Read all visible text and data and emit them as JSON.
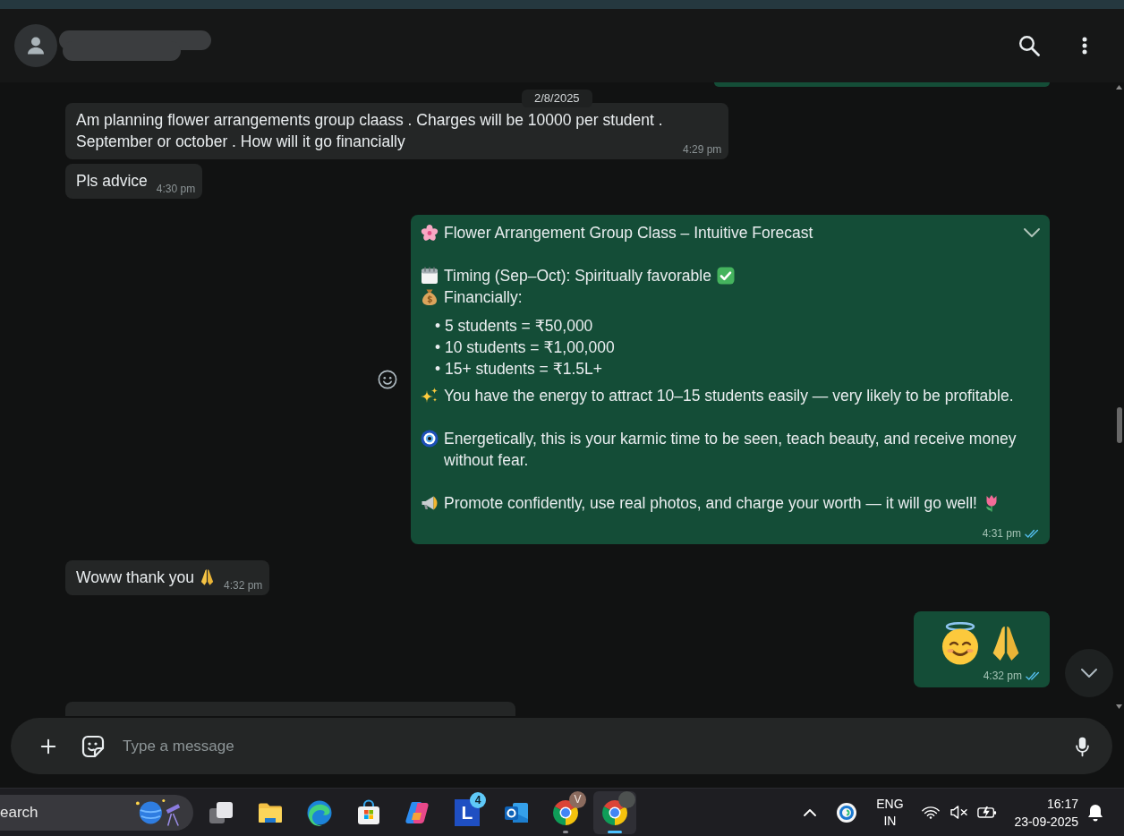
{
  "date_divider": "2/8/2025",
  "messages": [
    {
      "kind": "clipped",
      "outgoing": true
    },
    {
      "kind": "text",
      "outgoing": false,
      "hovered": false,
      "text": "Am planning flower arrangements group claass . Charges will be 10000 per student . September or october . How will it go financially",
      "time": "4:29 pm"
    },
    {
      "kind": "text",
      "outgoing": false,
      "hovered": false,
      "text": "Pls advice",
      "time": "4:30 pm"
    },
    {
      "kind": "forecast",
      "outgoing": true,
      "hovered": true,
      "paragraphs": [
        {
          "lines": [
            {
              "kind": "title",
              "text": "Flower Arrangement Group Class – Intuitive Forecast"
            }
          ]
        },
        {
          "lines": [
            {
              "kind": "timing",
              "text": "Timing (Sep–Oct): Spiritually favorable"
            },
            {
              "kind": "money",
              "text": "Financially:"
            },
            {
              "kind": "bullet",
              "text": "• 5 students = ₹50,000"
            },
            {
              "kind": "bullet",
              "text": "• 10 students = ₹1,00,000"
            },
            {
              "kind": "bullet",
              "text": "• 15+ students = ₹1.5L+"
            },
            {
              "kind": "sparkle",
              "text": "You have the energy to attract 10–15 students easily — very likely to be profitable."
            }
          ]
        },
        {
          "lines": [
            {
              "kind": "eye",
              "text": "Energetically, this is your karmic time to be seen, teach beauty, and receive money without fear."
            }
          ]
        },
        {
          "lines": [
            {
              "kind": "megaphone",
              "text": "Promote confidently, use real photos, and charge your worth — it will go well!"
            }
          ]
        }
      ],
      "time": "4:31 pm",
      "read": true
    },
    {
      "kind": "thanks",
      "outgoing": false,
      "hovered": false,
      "text": "Woww thank you",
      "time": "4:32 pm"
    },
    {
      "kind": "reaction",
      "outgoing": true,
      "hovered": false,
      "time": "4:32 pm",
      "read": true
    },
    {
      "kind": "clipped",
      "outgoing": false
    }
  ],
  "compose": {
    "placeholder": "Type a message"
  },
  "taskbar": {
    "search": {
      "placeholder": "earch"
    },
    "apps": [
      {
        "kind": "windows",
        "selected": false,
        "running": false
      },
      {
        "kind": "folder",
        "selected": false,
        "running": false
      },
      {
        "kind": "swirl",
        "selected": false,
        "running": false
      },
      {
        "kind": "bag",
        "selected": false,
        "running": false
      },
      {
        "kind": "ribbon",
        "selected": false,
        "running": false
      },
      {
        "kind": "tile",
        "label": "L",
        "badge": "4",
        "selected": false,
        "running": false
      },
      {
        "kind": "mail",
        "selected": false,
        "running": false
      },
      {
        "kind": "tricolor",
        "profile": {
          "kind": "letter",
          "text": "V"
        },
        "selected": false,
        "running": true
      },
      {
        "kind": "tricolor",
        "profile": {
          "kind": "photo"
        },
        "selected": true,
        "running": true
      }
    ],
    "tray": {
      "language": "ENG",
      "region": "IN",
      "sound_muted": true,
      "time": "16:17",
      "date": "23-09-2025"
    }
  }
}
